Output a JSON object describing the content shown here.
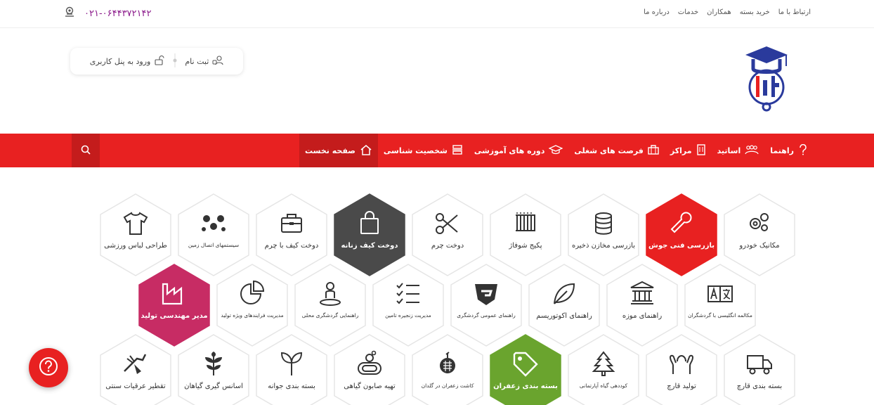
{
  "topbar": {
    "phone": "۰۲۱-۰۶۴۴۳۷۲۱۴۲",
    "links": [
      "درباره ما",
      "خدمات",
      "همکاران",
      "خرید بسته",
      "ارتباط با ما"
    ]
  },
  "login": {
    "register": "ثبت نام",
    "login": "ورود به پنل کاربری"
  },
  "nav": {
    "items": [
      {
        "label": "صفحه نخست",
        "icon": "home-icon",
        "active": true
      },
      {
        "label": "شخصیت شناسی",
        "icon": "persona-icon"
      },
      {
        "label": "دوره های آموزشی",
        "icon": "graduation-cap-icon"
      },
      {
        "label": "فرصت های شغلی",
        "icon": "briefcase-icon"
      },
      {
        "label": "مراکز",
        "icon": "building-icon"
      },
      {
        "label": "اساتید",
        "icon": "people-icon"
      },
      {
        "label": "راهنما",
        "icon": "question-icon"
      }
    ]
  },
  "colors": {
    "brand_red": "#e82121",
    "dark_red": "#c41c1c",
    "hex_dark": "#4a4a4a",
    "hex_pink": "#c72c64",
    "hex_green": "#6aa42e",
    "phone_purple": "#8b1a8b"
  },
  "hexes": {
    "row1": [
      {
        "label": "مکانیک خودرو",
        "icon": "gears-icon",
        "style": "light"
      },
      {
        "label": "بازرسی فنی جوش",
        "icon": "wrench-icon",
        "style": "red"
      },
      {
        "label": "بازرسی مخازن ذخیره",
        "icon": "database-icon",
        "style": "light"
      },
      {
        "label": "پکیج شوفاژ",
        "icon": "radiator-icon",
        "style": "light"
      },
      {
        "label": "دوخت چرم",
        "icon": "scissors-icon",
        "style": "light"
      },
      {
        "label": "دوخت کیف زنانه",
        "icon": "bag-icon",
        "style": "dark"
      },
      {
        "label": "دوخت کیف با چرم",
        "icon": "case-icon",
        "style": "light"
      },
      {
        "label": "سیستمهای اتصال زمین",
        "icon": "network-icon",
        "style": "light",
        "small": true
      },
      {
        "label": "طراحی لباس ورزشی",
        "icon": "tshirt-icon",
        "style": "light"
      }
    ],
    "row2": [
      {
        "label": "مکالمه انگلیسی با گردشگران",
        "icon": "translate-icon",
        "style": "light",
        "small": true
      },
      {
        "label": "راهنمای موزه",
        "icon": "museum-icon",
        "style": "light"
      },
      {
        "label": "راهنمای اکوتوریسم",
        "icon": "leaf-icon",
        "style": "light"
      },
      {
        "label": "راهنمای عمومی گردشگری",
        "icon": "shield-g-icon",
        "style": "light",
        "small": true
      },
      {
        "label": "مدیریت زنجیره تامین",
        "icon": "checklist-icon",
        "style": "light",
        "small": true
      },
      {
        "label": "راهنمایی گردشگری محلی",
        "icon": "person-location-icon",
        "style": "light",
        "small": true
      },
      {
        "label": "مدیریت فرایندهای ویژه تولید",
        "icon": "pie-chart-icon",
        "style": "light",
        "small": true
      },
      {
        "label": "مدیر مهندسی تولید",
        "icon": "factory-icon",
        "style": "pink"
      }
    ],
    "row3": [
      {
        "label": "بسته بندی قارچ",
        "icon": "truck-icon",
        "style": "light"
      },
      {
        "label": "تولید قارچ",
        "icon": "hands-icon",
        "style": "light"
      },
      {
        "label": "کوددهی گیاه آپارتمانی",
        "icon": "tree-icon",
        "style": "light",
        "small": true
      },
      {
        "label": "بسته بندی زعفران",
        "icon": "tag-icon",
        "style": "green"
      },
      {
        "label": "کاشت زعفران در گلدان",
        "icon": "pot-icon",
        "style": "light",
        "small": true
      },
      {
        "label": "تهیه صابون گیاهی",
        "icon": "soap-icon",
        "style": "light"
      },
      {
        "label": "بسته بندی جوانه",
        "icon": "sprout-icon",
        "style": "light"
      },
      {
        "label": "اسانس گیری گیاهان",
        "icon": "herb-icon",
        "style": "light"
      },
      {
        "label": "تقطیر عرقیات سنتی",
        "icon": "distill-icon",
        "style": "light"
      }
    ]
  }
}
